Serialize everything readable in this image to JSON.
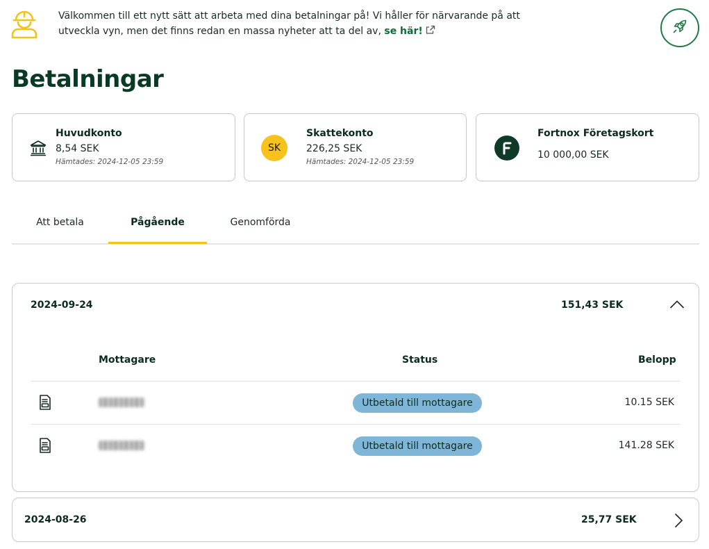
{
  "banner": {
    "text_line1": "Välkommen till ett nytt sätt att arbeta med dina betalningar på! Vi håller för närvarande på att",
    "text_line2": "utveckla vyn, men det finns redan en massa nyheter att ta del av, ",
    "link_label": "se här!",
    "worker_icon": "construction-worker-icon",
    "external_icon": "external-link-icon",
    "rocket_icon": "rocket-icon"
  },
  "page_title": "Betalningar",
  "accounts": [
    {
      "name": "Huvudkonto",
      "balance": "8,54 SEK",
      "fetched": "Hämtades: 2024-12-05 23:59",
      "icon": "bank-icon"
    },
    {
      "name": "Skattekonto",
      "badge": "SK",
      "balance": "226,25 SEK",
      "fetched": "Hämtades: 2024-12-05 23:59",
      "icon": "tax-account-badge"
    },
    {
      "name": "Fortnox Företagskort",
      "balance": "10 000,00 SEK",
      "icon": "fortnox-f-logo"
    }
  ],
  "tabs": [
    {
      "label": "Att betala",
      "active": false
    },
    {
      "label": "Pågående",
      "active": true
    },
    {
      "label": "Genomförda",
      "active": false
    }
  ],
  "groups": [
    {
      "date": "2024-09-24",
      "total": "151,43 SEK",
      "expanded": true,
      "columns": {
        "recipient": "Mottagare",
        "status": "Status",
        "amount": "Belopp"
      },
      "rows": [
        {
          "status": "Utbetald till mottagare",
          "amount": "10.15 SEK",
          "icon": "invoice-icon"
        },
        {
          "status": "Utbetald till mottagare",
          "amount": "141.28 SEK",
          "icon": "invoice-icon"
        }
      ]
    },
    {
      "date": "2024-08-26",
      "total": "25,77 SEK",
      "expanded": false
    }
  ],
  "colors": {
    "brand_green": "#0b3a24",
    "link_green": "#0b6b3a",
    "accent_yellow": "#f2c318",
    "status_blue": "#7fb5d6"
  }
}
